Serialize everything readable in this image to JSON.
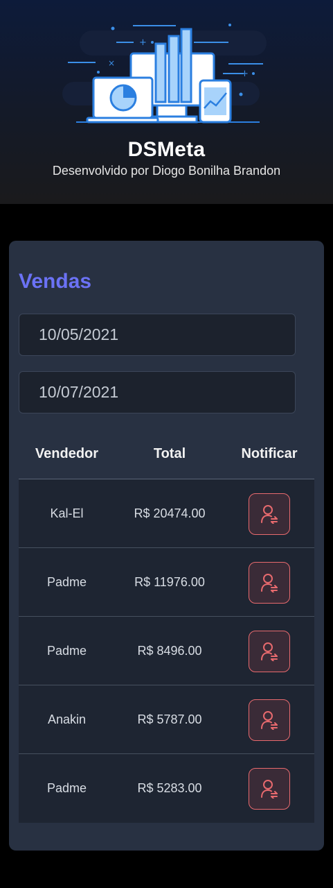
{
  "header": {
    "title": "DSMeta",
    "subtitle": "Desenvolvido por Diogo Bonilha Brandon",
    "logo_icon": "sales-dashboard-illustration"
  },
  "sales": {
    "title": "Vendas",
    "min_date": "10/05/2021",
    "max_date": "10/07/2021",
    "columns": [
      "Vendedor",
      "Total",
      "Notificar"
    ],
    "rows": [
      {
        "seller": "Kal-El",
        "total": "R$ 20474.00",
        "notify_icon": "notify-user-icon"
      },
      {
        "seller": "Padme",
        "total": "R$ 11976.00",
        "notify_icon": "notify-user-icon"
      },
      {
        "seller": "Padme",
        "total": "R$ 8496.00",
        "notify_icon": "notify-user-icon"
      },
      {
        "seller": "Anakin",
        "total": "R$ 5787.00",
        "notify_icon": "notify-user-icon"
      },
      {
        "seller": "Padme",
        "total": "R$ 5283.00",
        "notify_icon": "notify-user-icon"
      }
    ]
  },
  "colors": {
    "accent": "#6b72f5",
    "notify": "#e86a6e",
    "card_bg": "#283142",
    "row_bg": "#1e2532"
  }
}
